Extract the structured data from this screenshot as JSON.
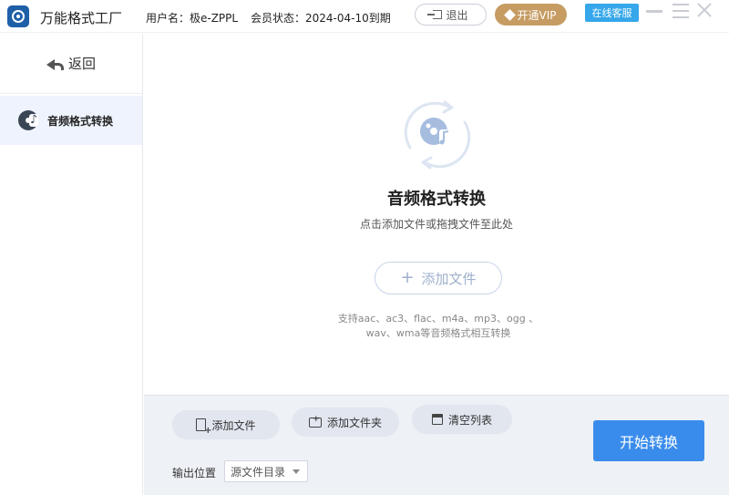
{
  "app": {
    "title": "万能格式工厂"
  },
  "header": {
    "user": "用户名：极e-ZPPL",
    "member": "会员状态：2024-04-10到期",
    "logout_label": "退出",
    "vip_label": "开通VIP",
    "service_label": "在线客服"
  },
  "sidebar": {
    "back_label": "返回",
    "items": [
      {
        "label": "音频格式转换",
        "icon": "audio-disc-icon",
        "selected": true
      }
    ]
  },
  "dropzone": {
    "title": "音频格式转换",
    "hint": "点击添加文件或拖拽文件至此处",
    "add_label": "添加文件",
    "support_line1": "支持aac、ac3、flac、m4a、mp3、ogg 、",
    "support_line2": "wav、wma等音频格式相互转换"
  },
  "toolbar": {
    "add_file_label": "添加文件",
    "add_folder_label": "添加文件夹",
    "clear_label": "清空列表",
    "output_label": "输出位置",
    "output_value": "源文件目录",
    "start_label": "开始转换"
  },
  "colors": {
    "accent": "#3a8cec",
    "vip": "#c69c63",
    "service": "#35a7ea",
    "sidebar_selected": "#eef3fd"
  }
}
